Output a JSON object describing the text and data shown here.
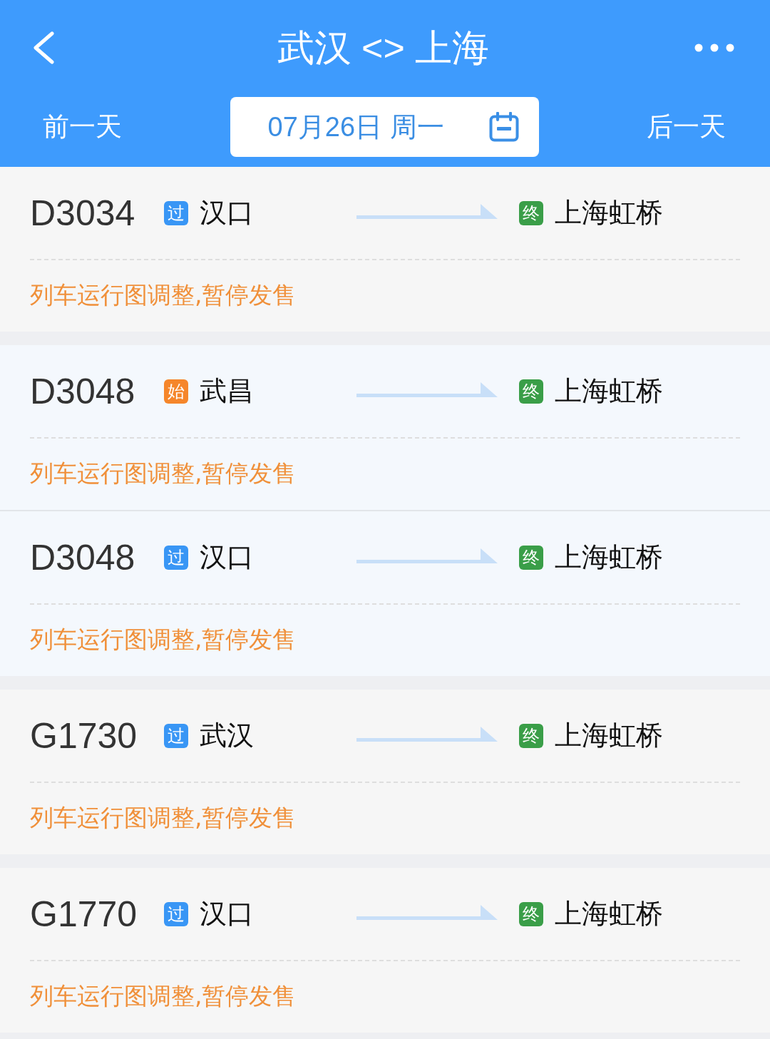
{
  "header": {
    "title": "武汉 <> 上海",
    "prev_day": "前一天",
    "date": "07月26日 周一",
    "next_day": "后一天"
  },
  "groups": [
    {
      "trains": [
        {
          "number": "D3034",
          "color": "#f6f6f6",
          "from": {
            "tag": "过",
            "kind": "pass",
            "station": "汉口"
          },
          "to": {
            "tag": "终",
            "kind": "end",
            "station": "上海虹桥"
          },
          "notice": "列车运行图调整,暂停发售"
        }
      ]
    },
    {
      "trains": [
        {
          "number": "D3048",
          "color": "#f4f8fd",
          "from": {
            "tag": "始",
            "kind": "start",
            "station": "武昌"
          },
          "to": {
            "tag": "终",
            "kind": "end",
            "station": "上海虹桥"
          },
          "notice": "列车运行图调整,暂停发售"
        },
        {
          "number": "D3048",
          "color": "#f4f8fd",
          "from": {
            "tag": "过",
            "kind": "pass",
            "station": "汉口"
          },
          "to": {
            "tag": "终",
            "kind": "end",
            "station": "上海虹桥"
          },
          "notice": "列车运行图调整,暂停发售"
        }
      ]
    },
    {
      "trains": [
        {
          "number": "G1730",
          "color": "#f6f6f6",
          "from": {
            "tag": "过",
            "kind": "pass",
            "station": "武汉"
          },
          "to": {
            "tag": "终",
            "kind": "end",
            "station": "上海虹桥"
          },
          "notice": "列车运行图调整,暂停发售"
        }
      ]
    },
    {
      "trains": [
        {
          "number": "G1770",
          "color": "#f6f6f6",
          "from": {
            "tag": "过",
            "kind": "pass",
            "station": "汉口"
          },
          "to": {
            "tag": "终",
            "kind": "end",
            "station": "上海虹桥"
          },
          "notice": "列车运行图调整,暂停发售"
        }
      ]
    }
  ]
}
